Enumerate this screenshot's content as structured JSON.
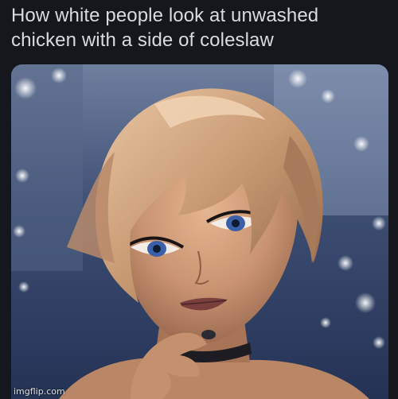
{
  "caption": {
    "line1": "How white people look at unwashed",
    "line2": "chicken with a side of coleslaw"
  },
  "image": {
    "subject": "animated-character-portrait"
  },
  "watermark": "imgflip.com",
  "colors": {
    "background": "#15171c",
    "caption_text": "#d9dbe0"
  }
}
